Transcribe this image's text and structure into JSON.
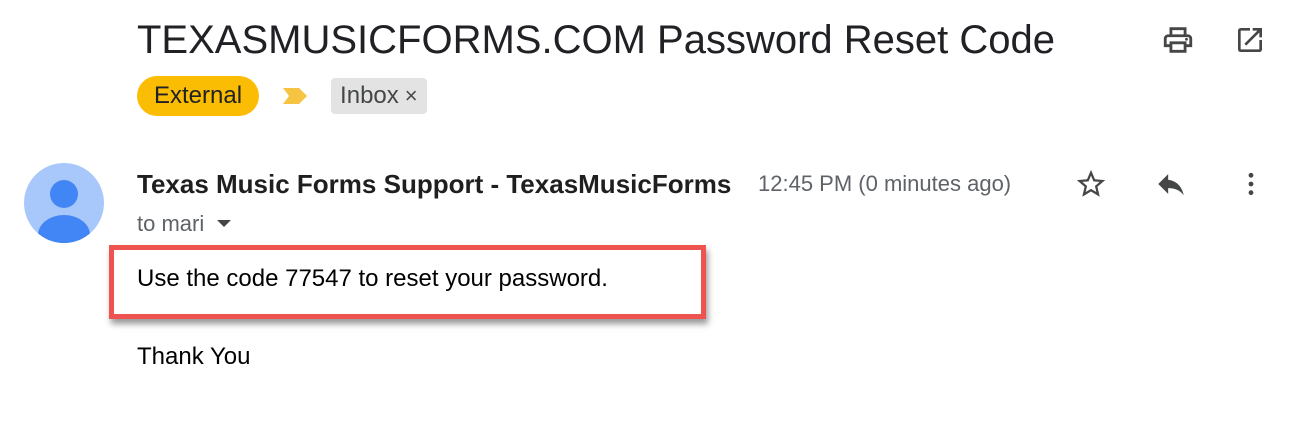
{
  "email": {
    "subject": "TEXASMUSICFORMS.COM Password Reset Code",
    "labels": {
      "external": "External",
      "inbox": "Inbox",
      "inbox_remove": "×"
    },
    "sender": "Texas Music Forms Support - TexasMusicForms",
    "timestamp": "12:45 PM (0 minutes ago)",
    "recipient": "to mari",
    "body": {
      "line1": "Use the code 77547 to reset your password.",
      "line2": "Thank You"
    }
  },
  "icons": {
    "print": "print-icon",
    "popout": "open-in-new-window-icon",
    "importance": "importance-marker-icon",
    "star": "star-icon",
    "reply": "reply-icon",
    "more": "more-vertical-icon",
    "recipient_dropdown": "caret-down-icon",
    "avatar": "person-avatar-icon"
  },
  "colors": {
    "external_label": "#fbbc04",
    "inbox_label_bg": "#e3e3e3",
    "avatar_bg": "#a8c7fa",
    "avatar_fg": "#4285f4",
    "highlight_border": "#ef5350",
    "importance_marker": "#f6c342"
  }
}
